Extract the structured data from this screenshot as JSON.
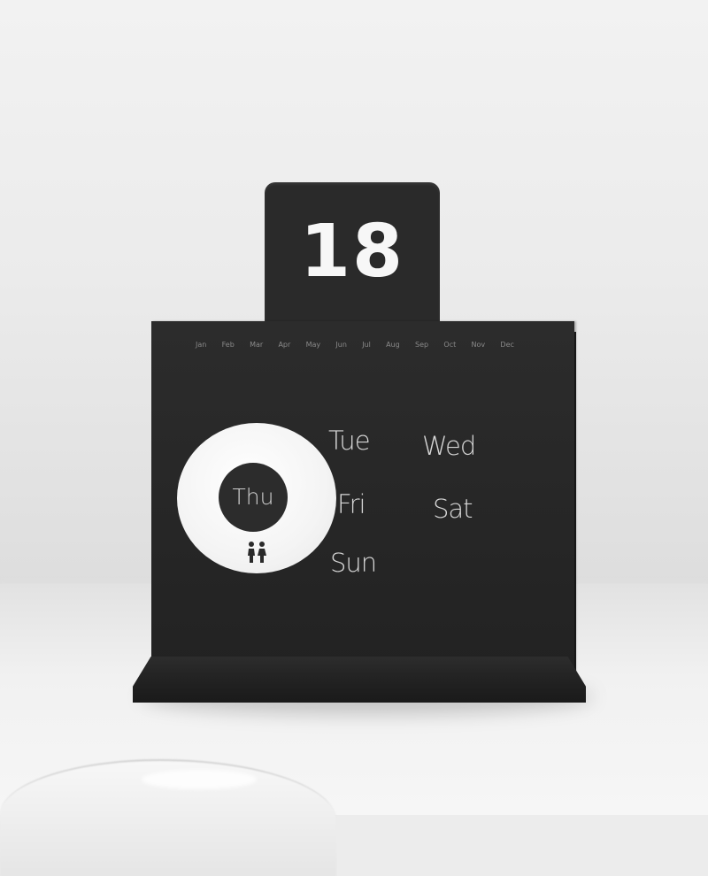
{
  "calendar": {
    "day_number": "18",
    "months": [
      "Jan",
      "Feb",
      "Mar",
      "Apr",
      "May",
      "Jun",
      "Jul",
      "Aug",
      "Sep",
      "Oct",
      "Nov",
      "Dec"
    ],
    "selected_weekday": "Thu",
    "weekdays": {
      "tue": "Tue",
      "wed": "Wed",
      "fri": "Fri",
      "sat": "Sat",
      "sun": "Sun"
    },
    "ring_icon": "people-icon"
  },
  "colors": {
    "board": "#2a2a2a",
    "ring": "#f5f5f5",
    "background": "#ececec"
  }
}
